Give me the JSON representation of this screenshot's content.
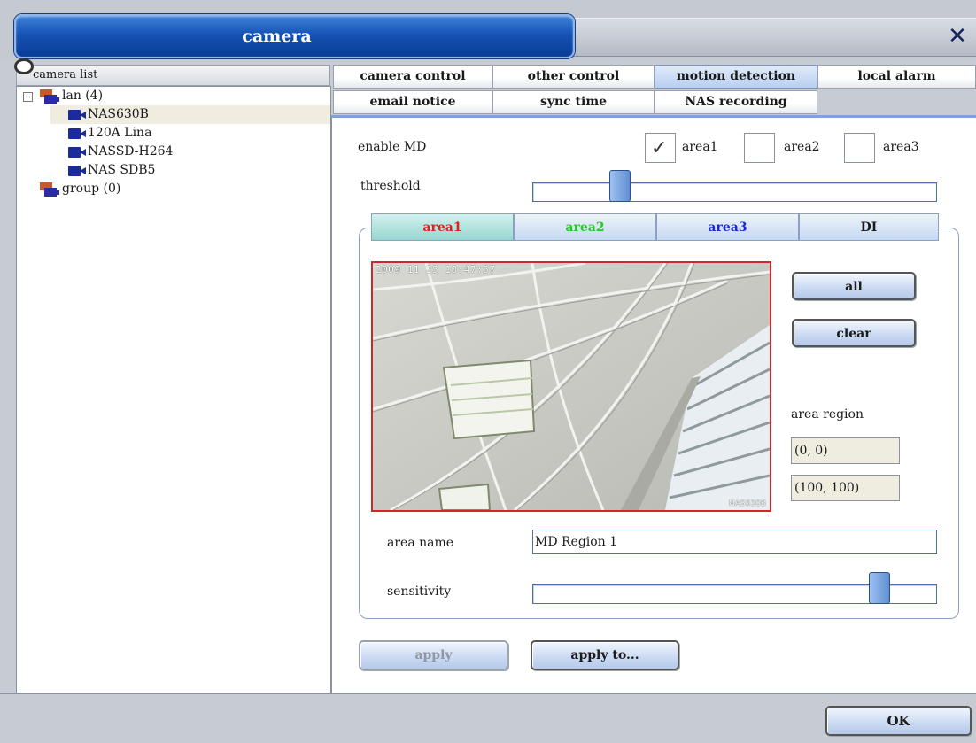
{
  "window": {
    "title": "camera",
    "close_glyph": "✕"
  },
  "camera_list": {
    "header": "camera list",
    "groups": [
      {
        "label": "lan (4)",
        "cameras": [
          "NAS630B",
          "120A Lina",
          "NASSD-H264",
          "NAS SDB5"
        ],
        "selected": "NAS630B"
      },
      {
        "label": "group (0)",
        "cameras": []
      }
    ]
  },
  "tabs": {
    "row1": [
      "camera control",
      "other control",
      "motion detection",
      "local alarm"
    ],
    "row2": [
      "email notice",
      "sync time",
      "NAS recording"
    ],
    "active": "motion detection"
  },
  "md": {
    "enable_label": "enable MD",
    "areas": [
      {
        "label": "area1",
        "checked": true
      },
      {
        "label": "area2",
        "checked": false
      },
      {
        "label": "area3",
        "checked": false
      }
    ],
    "threshold_label": "threshold",
    "threshold_value": 0.2,
    "subtabs": [
      {
        "label": "area1",
        "color": "#e0201a"
      },
      {
        "label": "area2",
        "color": "#22dd22"
      },
      {
        "label": "area3",
        "color": "#1a2ad0"
      },
      {
        "label": "DI",
        "color": "#1a1a1a"
      }
    ],
    "active_subtab": "area1",
    "video": {
      "timestamp": "2009 11 25 10:47:57",
      "camera_label": "NAS630B"
    },
    "all_button": "all",
    "clear_button": "clear",
    "area_region_label": "area region",
    "region_start": "(0, 0)",
    "region_end": "(100, 100)",
    "area_name_label": "area name",
    "area_name_value": "MD Region 1",
    "sensitivity_label": "sensitivity",
    "sensitivity_value": 0.88
  },
  "buttons": {
    "apply": "apply",
    "apply_to": "apply to...",
    "ok": "OK"
  },
  "colors": {
    "title_blue": "#1653b5",
    "active_tab": "#b9cff0",
    "video_border": "#d3262a"
  }
}
